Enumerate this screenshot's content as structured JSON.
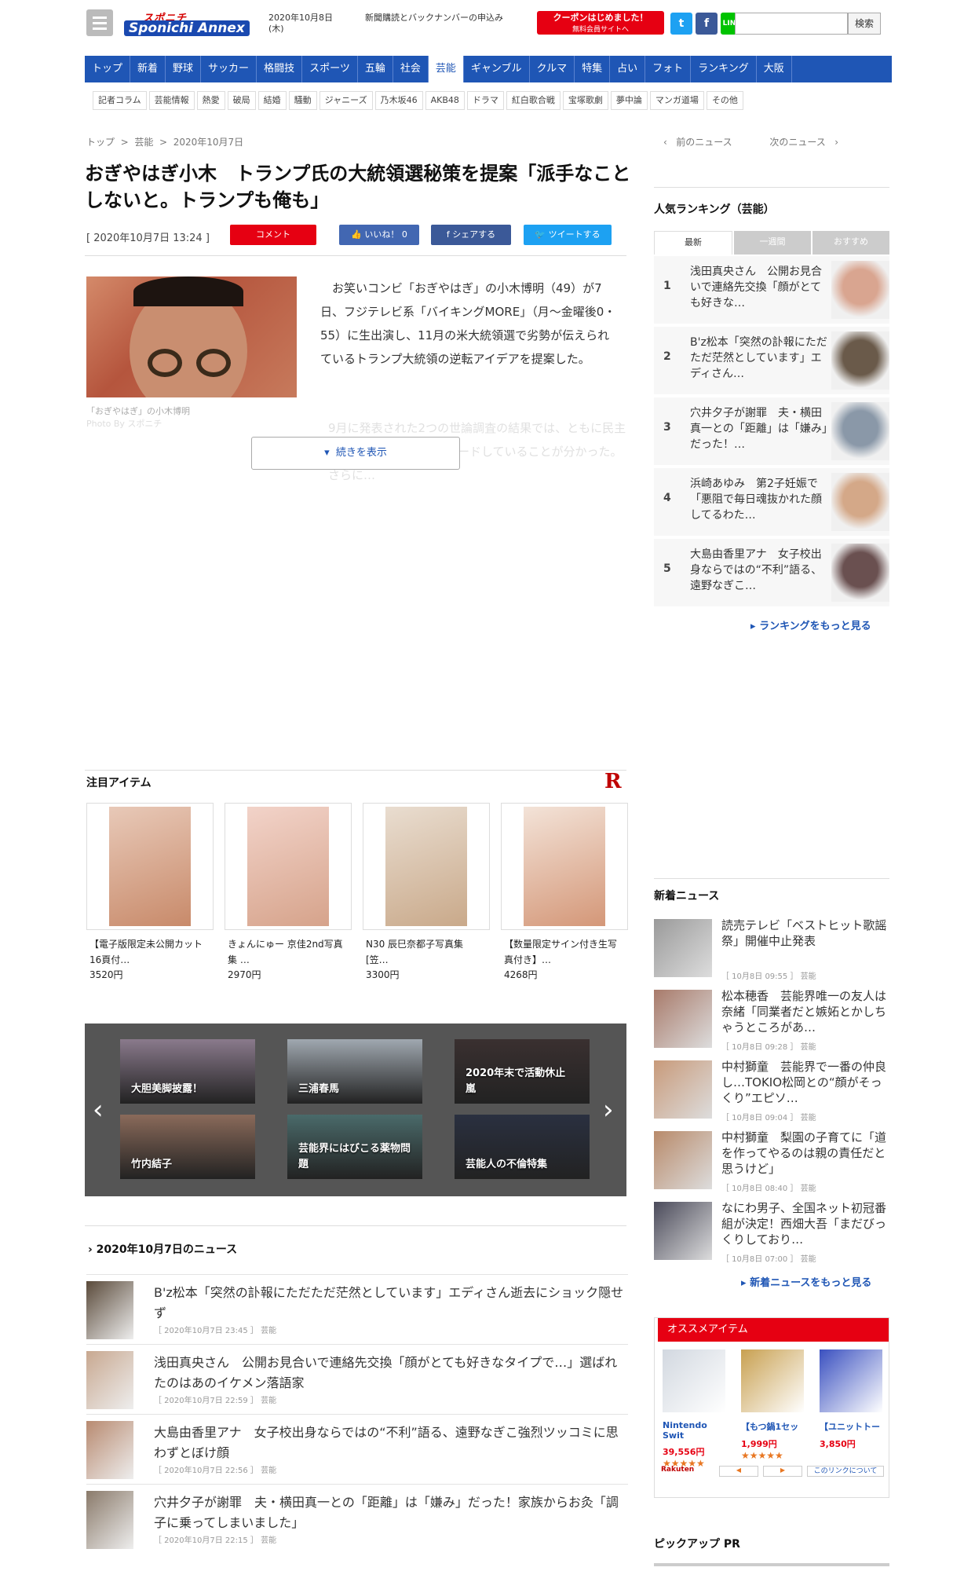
{
  "header": {
    "logo_top": "スポニチ",
    "logo_main": "Sponichi Annex",
    "date_line1": "2020年10月8日",
    "date_line2": "(木)",
    "subscribe_link": "新聞購読とバックナンバーの申込み",
    "coupon_main": "クーポンはじめました！",
    "coupon_sub": "無料会員サイトへ",
    "twitter_glyph": "t",
    "facebook_glyph": "f",
    "line_label": "LINE",
    "search_button": "検索",
    "search_value": ""
  },
  "nav": [
    "トップ",
    "新着",
    "野球",
    "サッカー",
    "格闘技",
    "スポーツ",
    "五輪",
    "社会",
    "芸能",
    "ギャンブル",
    "クルマ",
    "特集",
    "占い",
    "フォト",
    "ランキング",
    "大阪"
  ],
  "subnav": [
    "記者コラム",
    "芸能情報",
    "熱愛",
    "破局",
    "結婚",
    "騒動",
    "ジャニーズ",
    "乃木坂46",
    "AKB48",
    "ドラマ",
    "紅白歌合戦",
    "宝塚歌劇",
    "夢中論",
    "マンガ道場",
    "その他"
  ],
  "breadcrumb": {
    "home": "トップ",
    "sep": ">",
    "cat": "芸能",
    "date": "2020年10月7日"
  },
  "pager": {
    "prev": "前のニュース",
    "next": "次のニュース"
  },
  "article": {
    "title": "おぎやはぎ小木　トランプ氏の大統領選秘策を提案「派手なことしないと。トランプも俺も」",
    "date": "[ 2020年10月7日 13:24 ]",
    "comment_btn": "コメント",
    "like_btn": "いいね！ 0",
    "share_btn": "シェアする",
    "tweet_btn": "ツイートする",
    "caption": "「おぎやはぎ」の小木博明",
    "photo_by": "Photo By スポニチ",
    "body": "お笑いコンビ「おぎやはぎ」の小木博明（49）が7日、フジテレビ系「バイキングMORE」（月～金曜後0・55）に生出演し、11月の米大統領選で劣勢が伝えられているトランプ大統領の逆転アイデアを提案した。",
    "body_faded": "9月に発表された2つの世論調査の結果では、ともに民主党候補のバイデン氏がリードしていることが分かった。さらに…",
    "show_more": "続きを表示"
  },
  "featured": {
    "heading": "注目アイテム",
    "rakuten_glyph": "R",
    "items": [
      {
        "name": "【電子版限定未公開カット16頁付…",
        "price": "3520円"
      },
      {
        "name": "きょんにゅー 京佳2nd写真集 …",
        "price": "2970円"
      },
      {
        "name": "N30 辰巳奈都子写真集 [笠…",
        "price": "3300円"
      },
      {
        "name": "【数量限定サイン付き生写真付き】…",
        "price": "4268円"
      }
    ]
  },
  "carousel": {
    "prev": "‹",
    "next": "›",
    "tiles": [
      "大胆美脚披露！",
      "三浦春馬",
      "2020年末で活動休止\n嵐",
      "竹内結子",
      "芸能界にはびこる薬物問題",
      "芸能人の不倫特集"
    ]
  },
  "daynews": {
    "heading": "2020年10月7日のニュース",
    "items": [
      {
        "title": "B'z松本「突然の訃報にただただ茫然としています」エディさん逝去にショック隠せず",
        "meta": "［ 2020年10月7日 23:45 ］ 芸能"
      },
      {
        "title": "浅田真央さん　公開お見合いで連絡先交換「顔がとても好きなタイプで…」選ばれたのはあのイケメン落語家",
        "meta": "［ 2020年10月7日 22:59 ］ 芸能"
      },
      {
        "title": "大島由香里アナ　女子校出身ならではの“不利”語る、遠野なぎこ強烈ツッコミに思わずとぼけ顔",
        "meta": "［ 2020年10月7日 22:56 ］ 芸能"
      },
      {
        "title": "穴井夕子が謝罪　夫・横田真一との「距離」は「嫌み」だった！家族からお灸「調子に乗ってしまいました」",
        "meta": "［ 2020年10月7日 22:15 ］ 芸能"
      }
    ]
  },
  "ranking": {
    "heading": "人気ランキング（芸能）",
    "tabs": [
      "最新",
      "一週間",
      "おすすめ"
    ],
    "items": [
      {
        "rank": "1",
        "title": "浅田真央さん　公開お見合いで連絡先交換「顔がとても好きな…"
      },
      {
        "rank": "2",
        "title": "B'z松本「突然の訃報にただただ茫然としています」エディさん…"
      },
      {
        "rank": "3",
        "title": "穴井夕子が謝罪　夫・横田真一との「距離」は「嫌み」だった！…"
      },
      {
        "rank": "4",
        "title": "浜崎あゆみ　第2子妊娠で「悪阻で毎日魂抜かれた顔してるわた…"
      },
      {
        "rank": "5",
        "title": "大島由香里アナ　女子校出身ならではの“不利”語る、遠野なぎこ…"
      }
    ],
    "more": "ランキングをもっと見る"
  },
  "newnews": {
    "heading": "新着ニュース",
    "items": [
      {
        "title": "読売テレビ「ベストヒット歌謡祭」開催中止発表",
        "meta": "［ 10月8日 09:55 ］ 芸能"
      },
      {
        "title": "松本穂香　芸能界唯一の友人は奈緒「同業者だと嫉妬とかしちゃうところがあ…",
        "meta": "［ 10月8日 09:28 ］ 芸能"
      },
      {
        "title": "中村獅童　芸能界で一番の仲良し…TOKIO松岡との“顔がそっくり”エピソ…",
        "meta": "［ 10月8日 09:04 ］ 芸能"
      },
      {
        "title": "中村獅童　梨園の子育てに「道を作ってやるのは親の責任だと思うけど」",
        "meta": "［ 10月8日 08:40 ］ 芸能"
      },
      {
        "title": "なにわ男子、全国ネット初冠番組が決定！西畑大吾「まだびっくりしており…",
        "meta": "［ 10月8日 07:00 ］ 芸能"
      }
    ],
    "more": "新着ニュースをもっと見る"
  },
  "osusume": {
    "heading": "オススメアイテム",
    "items": [
      {
        "name": "Nintendo Swit",
        "price": "39,556円"
      },
      {
        "name": "【もつ鍋1セッ",
        "price": "1,999円"
      },
      {
        "name": "【ユニットトー",
        "price": "3,850円"
      }
    ],
    "stars": "★★★★★",
    "rakuten_label": "Rakuten",
    "about_link": "このリンクについて",
    "prev": "◀",
    "next": "▶"
  },
  "pickup": {
    "heading": "ピックアップ PR"
  }
}
